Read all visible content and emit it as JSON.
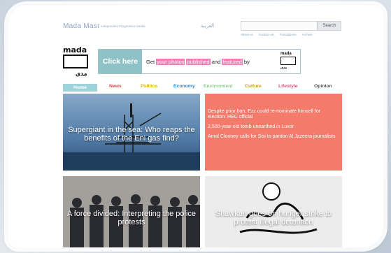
{
  "header": {
    "site_title": "Mada Masr",
    "site_subtitle": "Independent Progressive Media",
    "arabic_link": "العربية",
    "search_placeholder": "",
    "search_button": "Search",
    "links": [
      "About us",
      "Contact us",
      "Translations",
      "Archive"
    ]
  },
  "logo": {
    "word": "mada",
    "arabic": "مدى"
  },
  "banner": {
    "click_label": "Click here",
    "text_before": "Get",
    "hl1": "your photos",
    "hl2": "published",
    "text_mid": "and",
    "hl3": "featured",
    "text_after": "by",
    "mini_word": "mada",
    "mini_arabic": "مدى"
  },
  "nav": [
    {
      "label": "Home",
      "color": "#ffffff"
    },
    {
      "label": "News",
      "color": "#e24a4a"
    },
    {
      "label": "Politics",
      "color": "#d7b80f"
    },
    {
      "label": "Economy",
      "color": "#2c8bd0"
    },
    {
      "label": "Environment",
      "color": "#8fcf8a"
    },
    {
      "label": "Culture",
      "color": "#c7a012"
    },
    {
      "label": "Lifestyle",
      "color": "#e24a7f"
    },
    {
      "label": "Opinion",
      "color": "#555555"
    }
  ],
  "tiles": {
    "t1_title": "Supergiant in the sea: Who reaps the benefits of the Eni gas find?",
    "headlines": [
      "Despite prior ban, Ezz could re-nominate himself for election: HEC official",
      "2,500-year-old tomb unearthed in Luxor",
      "Amal Clooney calls for Sisi to pardon Al Jazeera journalists"
    ],
    "t3_title": "A force divided: Interpreting the police protests",
    "t4_title": "Shawkan goes on hunger strike to protest illegal detention"
  }
}
